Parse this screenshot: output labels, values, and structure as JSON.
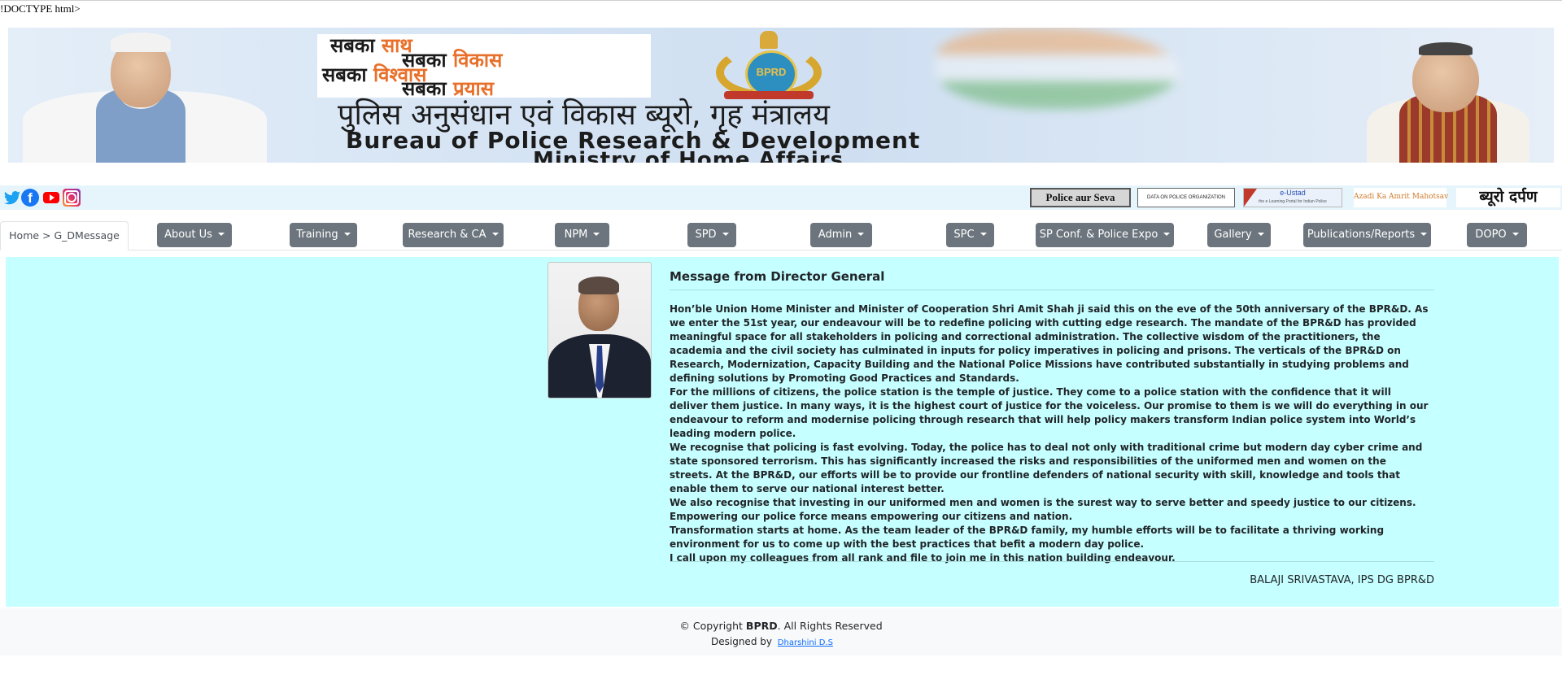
{
  "doctype_text": "!DOCTYPE html>",
  "banner": {
    "slogan": {
      "line1_dark": "सबका",
      "line1_accent": "साथ",
      "line2_dark": "सबका",
      "line2_accent": "विकास",
      "line3_dark": "सबका",
      "line3_accent": "विश्वास",
      "line4_dark": "सबका",
      "line4_accent": "प्रयास"
    },
    "emblem_text": "BPRD",
    "hindi_title": "पुलिस अनुसंधान एवं विकास ब्यूरो, गृह मंत्रालय",
    "english_title": "Bureau of Police Research & Development",
    "ministry": "Ministry of Home Affairs"
  },
  "social": {
    "twitter_icon": "twitter-icon",
    "facebook_icon": "facebook-icon",
    "facebook_glyph": "f",
    "youtube_icon": "youtube-icon",
    "instagram_icon": "instagram-icon"
  },
  "quick_links": {
    "police_aur_seva": "Police aur Seva",
    "data_on_police": "DATA ON POLICE ORGANIZATION",
    "eustad_title": "e-Ustad",
    "eustad_sub": "the e Learning Portal for Indian Police",
    "azadi": "Azadi Ka Amrit Mahotsav",
    "bureau_darpan": "ब्यूरो दर्पण"
  },
  "breadcrumb": "Home > G_DMessage",
  "nav": [
    {
      "label": "About Us"
    },
    {
      "label": "Training"
    },
    {
      "label": "Research & CA"
    },
    {
      "label": "NPM"
    },
    {
      "label": "SPD"
    },
    {
      "label": "Admin"
    },
    {
      "label": "SPC"
    },
    {
      "label": "SP Conf. & Police Expo"
    },
    {
      "label": "Gallery"
    },
    {
      "label": "Publications/Reports"
    },
    {
      "label": "DOPO"
    }
  ],
  "message": {
    "title": "Message from Director General",
    "paragraphs": [
      "Hon’ble Union Home Minister and Minister of Cooperation Shri Amit Shah ji said this on the eve of the 50th anniversary of the BPR&D. As we enter the 51st year, our endeavour will be to redefine policing with cutting edge research. The mandate of the BPR&D has provided meaningful space for all stakeholders in policing and correctional administration. The collective wisdom of the practitioners, the academia and the civil society has culminated in inputs for policy imperatives in policing and prisons. The verticals of the BPR&D on Research, Modernization, Capacity Building and the National Police Missions have contributed substantially in studying problems and defining solutions by Promoting Good Practices and Standards.",
      "For the millions of citizens, the police station is the temple of justice. They come to a police station with the confidence that it will deliver them justice. In many ways, it is the highest court of justice for the voiceless. Our promise to them is we will do everything in our endeavour to reform and modernise policing through research that will help policy makers transform Indian police system into World’s leading modern police.",
      "We recognise that policing is fast evolving. Today, the police has to deal not only with traditional crime but modern day cyber crime and state sponsored terrorism. This has significantly increased the risks and responsibilities of the uniformed men and women on the streets. At the BPR&D, our efforts will be to provide our frontline defenders of national security with skill, knowledge and tools that enable them to serve our national interest better.",
      "We also recognise that investing in our uniformed men and women is the surest way to serve better and speedy justice to our citizens. Empowering our police force means empowering our citizens and nation.",
      "Transformation starts at home. As the team leader of the BPR&D family, my humble efforts will be to facilitate a thriving working environment for us to come up with the best practices that befit a modern day police.",
      "I call upon my colleagues from all rank and file to join me in this nation building endeavour."
    ],
    "signature": "BALAJI SRIVASTAVA, IPS DG BPR&D"
  },
  "footer": {
    "copyright_prefix": "© Copyright",
    "copyright_brand": "BPRD",
    "copyright_suffix": ". All Rights Reserved",
    "designed_by": "Designed by",
    "designer": "Dharshini D.S"
  }
}
